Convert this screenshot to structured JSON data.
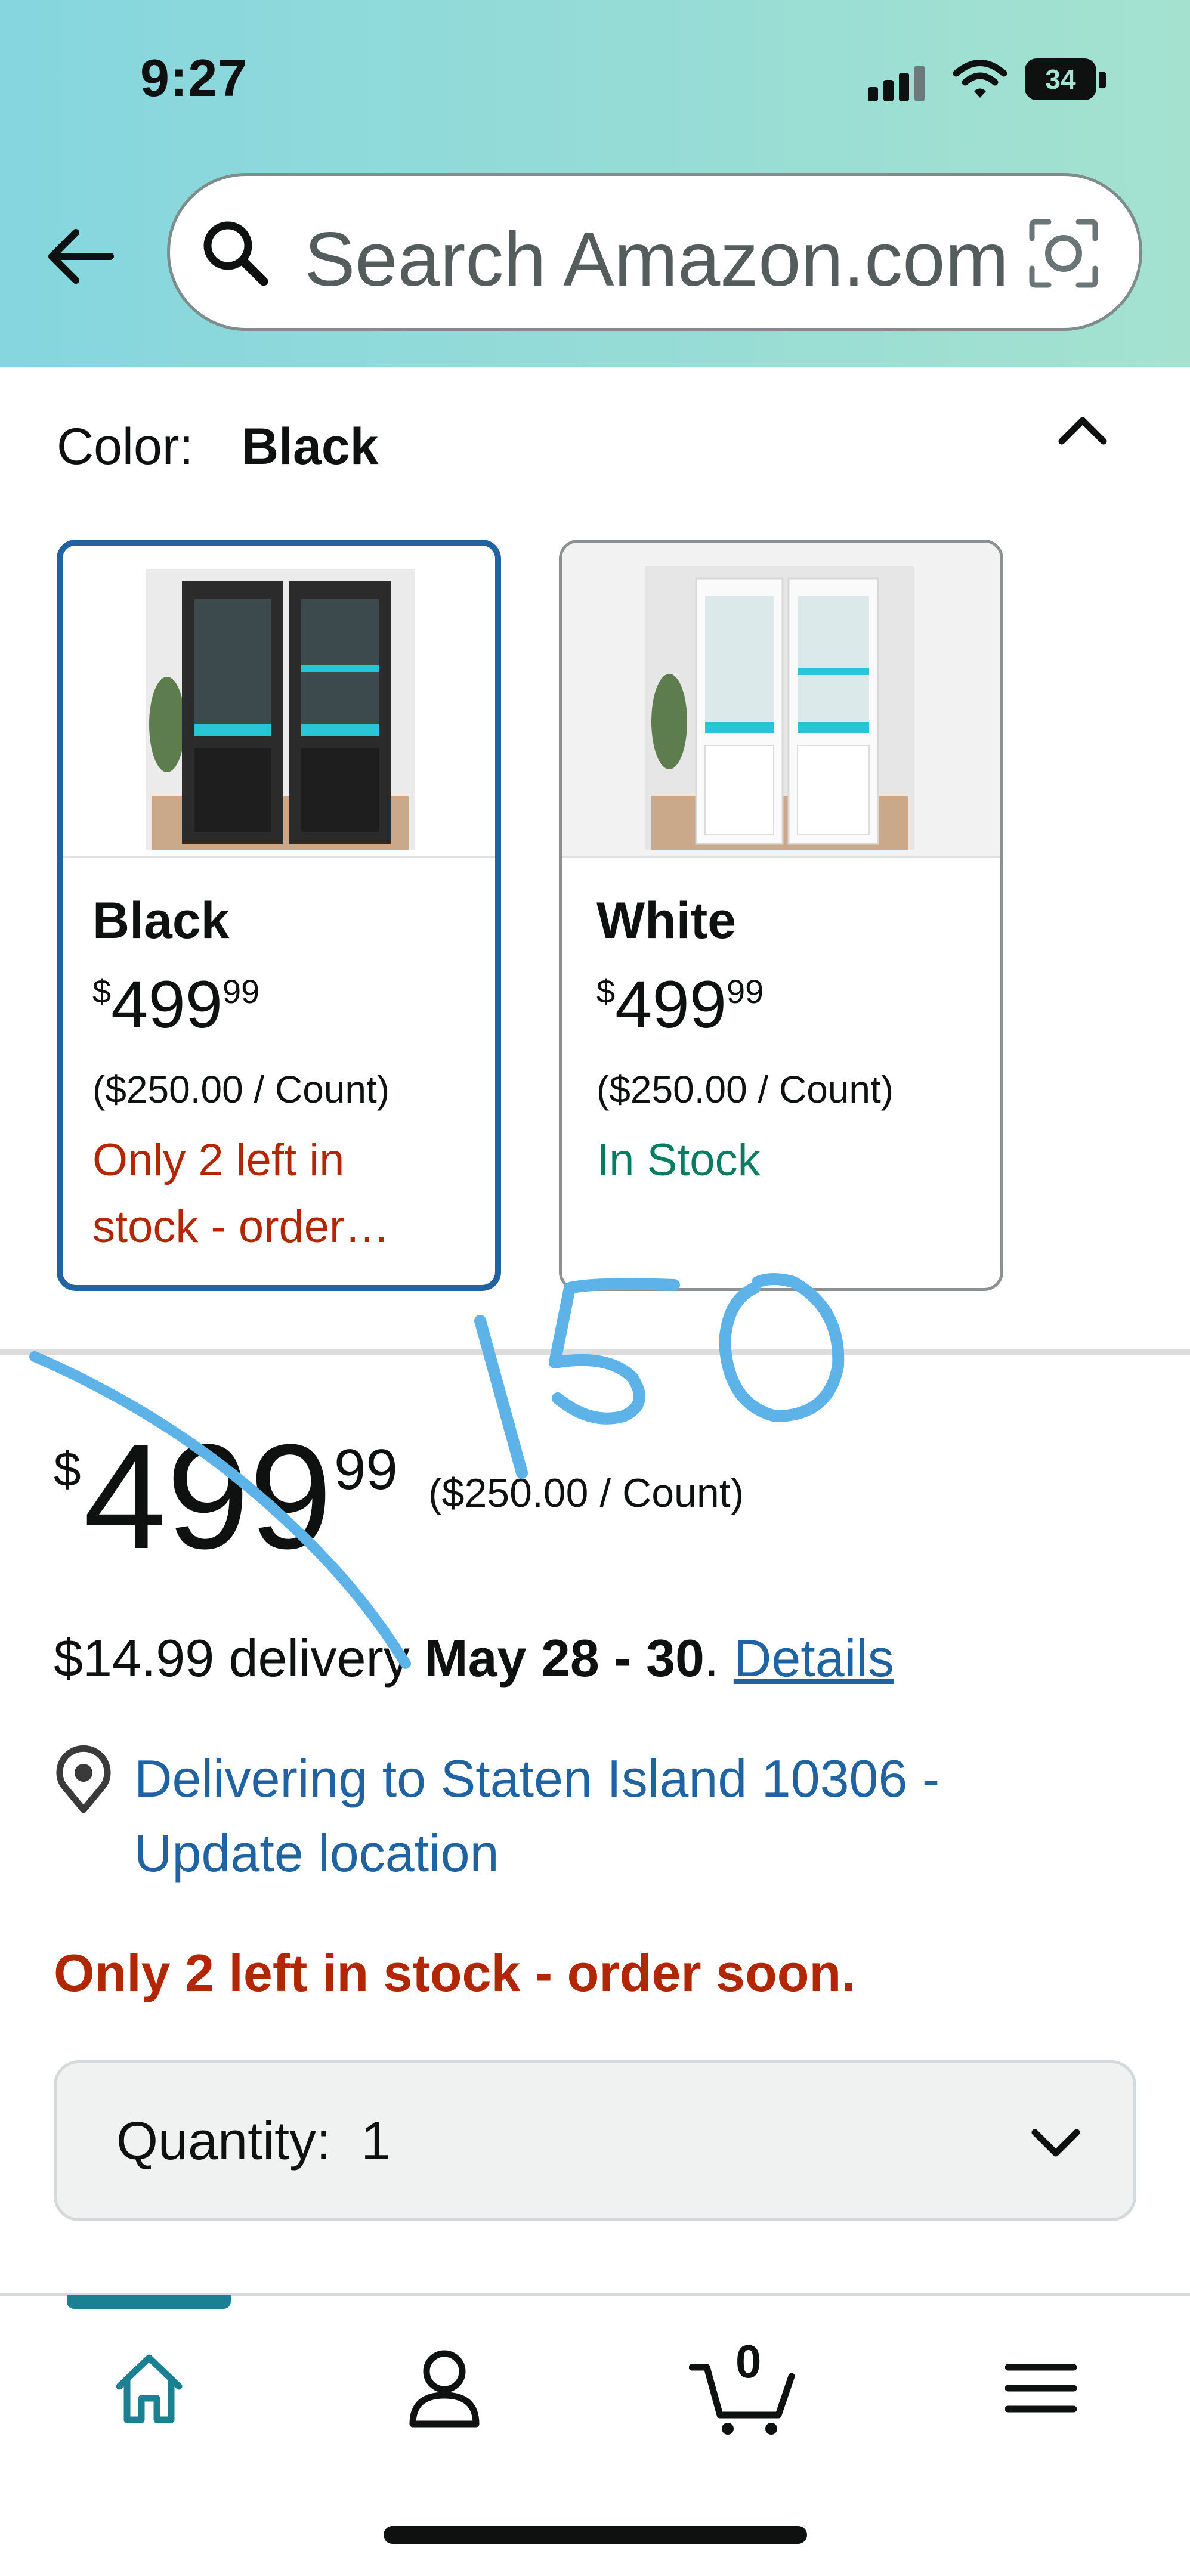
{
  "status_bar": {
    "time": "9:27",
    "battery": "34"
  },
  "header": {
    "search_placeholder": "Search Amazon.com",
    "back_icon": "back-arrow-icon",
    "search_icon": "search-icon",
    "camera_icon": "camera-icon"
  },
  "color_section": {
    "label": "Color:",
    "selected_value": "Black",
    "options": [
      {
        "name": "Black",
        "price_symbol": "$",
        "price_whole": "499",
        "price_fraction": "99",
        "unit_price": "($250.00 / Count)",
        "stock_line1": "Only 2 left in",
        "stock_line2": "stock - order…",
        "stock_color": "#b12704",
        "selected": true
      },
      {
        "name": "White",
        "price_symbol": "$",
        "price_whole": "499",
        "price_fraction": "99",
        "unit_price": "($250.00 / Count)",
        "stock_line1": "In Stock",
        "stock_color": "#067d62",
        "selected": false
      }
    ]
  },
  "price": {
    "symbol": "$",
    "whole": "499",
    "fraction": "99",
    "unit_price": "($250.00 / Count)"
  },
  "delivery": {
    "fee": "$14.99 delivery ",
    "dates": "May 28 - 30",
    "period": ".",
    "details_link": "Details"
  },
  "location": {
    "line1": "Delivering to Staten Island 10306 -",
    "line2": "Update location"
  },
  "stock_warning": "Only 2 left in stock - order soon.",
  "quantity": {
    "label": "Quantity:",
    "value": "1"
  },
  "bottom_nav": {
    "cart_count": "0",
    "items": [
      "home-icon",
      "account-icon",
      "cart-icon",
      "menu-icon"
    ],
    "active": "home-icon"
  },
  "annotation": {
    "text": "150"
  },
  "colors": {
    "accent_blue": "#2162a1",
    "warning_red": "#b12704",
    "in_stock_green": "#067d62",
    "nav_teal": "#1a8092",
    "annotation_blue": "#5db3e8"
  }
}
